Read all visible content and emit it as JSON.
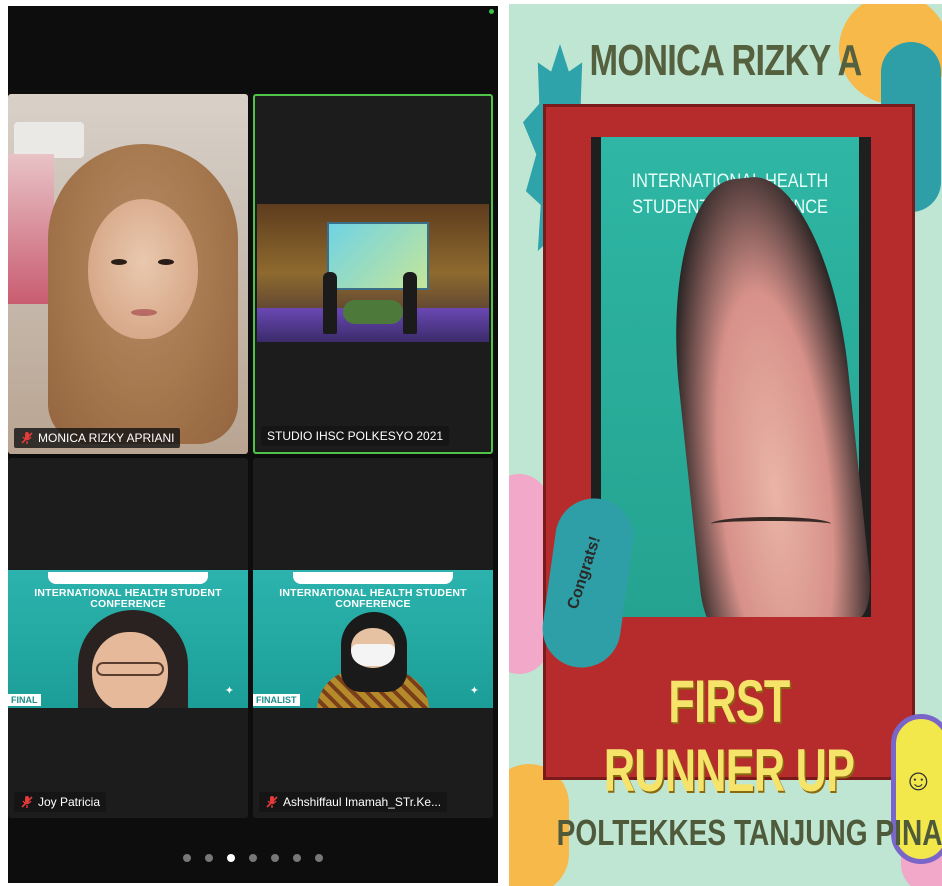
{
  "gallery": {
    "participants": [
      {
        "name": "MONICA RIZKY APRIANI",
        "muted": true
      },
      {
        "name": "STUDIO IHSC POLKESYO 2021",
        "muted": false
      },
      {
        "name": "Joy Patricia",
        "muted": true
      },
      {
        "name": "Ashshiffaul Imamah_STr.Ke...",
        "muted": true
      }
    ],
    "conference_title": "INTERNATIONAL HEALTH STUDENT CONFERENCE",
    "finalist_badge_3": "FINAL",
    "finalist_badge_4": "FINALIST",
    "page_count": 7,
    "active_page": 3
  },
  "card": {
    "winner_name": "MONICA RIZKY A",
    "video_title": "INTERNATIONAL HEALTH STUDENT CONFERENCE",
    "award": "FIRST RUNNER UP",
    "institution": "POLTEKKES TANJUNG PINANG",
    "bubble_text": "Congrats!"
  },
  "colors": {
    "active_speaker": "#4fc34a",
    "conference_teal": "#2cb3ad",
    "card_bg": "#bfe6d3",
    "frame_red": "#b62c2c",
    "award_yellow": "#f6e36a"
  }
}
